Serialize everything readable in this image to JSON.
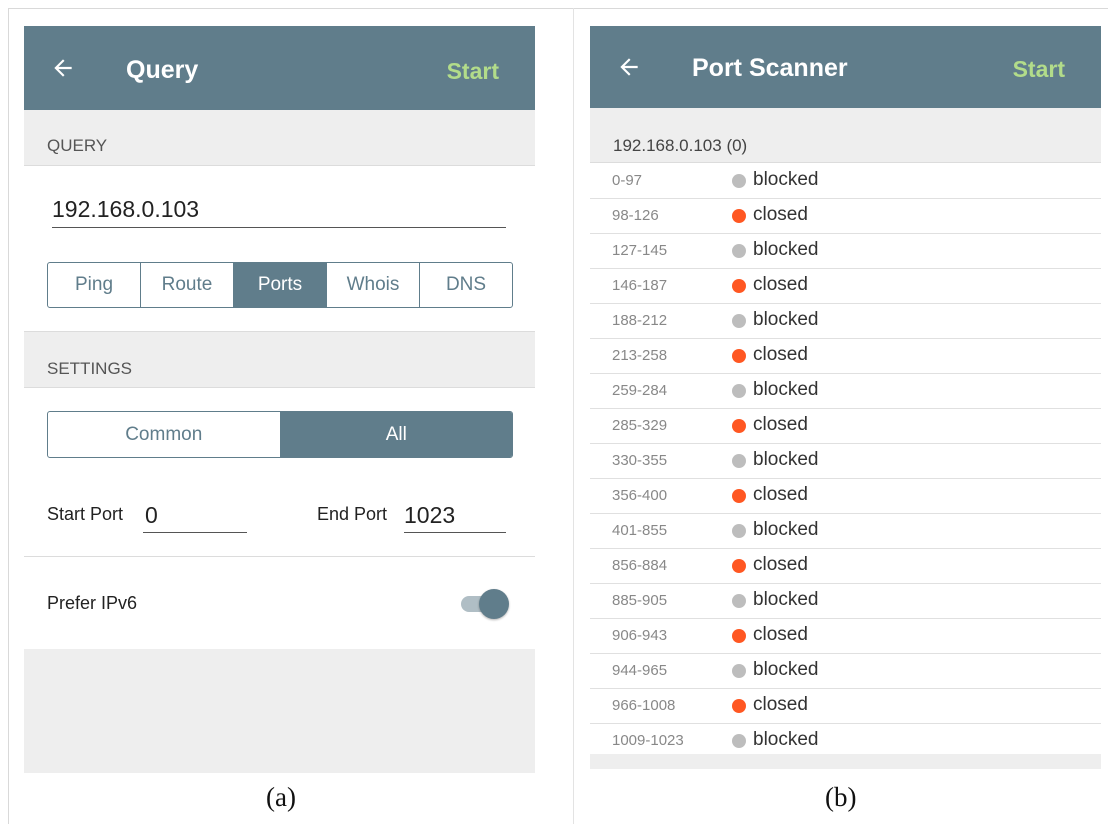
{
  "captions": {
    "a": "(a)",
    "b": "(b)"
  },
  "query_screen": {
    "appbar": {
      "back_icon": "arrow-left-icon",
      "title": "Query",
      "action": "Start"
    },
    "query_section": {
      "header": "QUERY",
      "ip_value": "192.168.0.103"
    },
    "tools": [
      {
        "label": "Ping",
        "active": false
      },
      {
        "label": "Route",
        "active": false
      },
      {
        "label": "Ports",
        "active": true
      },
      {
        "label": "Whois",
        "active": false
      },
      {
        "label": "DNS",
        "active": false
      }
    ],
    "settings": {
      "header": "SETTINGS",
      "scan_mode": [
        {
          "label": "Common",
          "active": false
        },
        {
          "label": "All",
          "active": true
        }
      ],
      "start_port_label": "Start Port",
      "start_port_value": "0",
      "end_port_label": "End Port",
      "end_port_value": "1023",
      "prefer_ipv6_label": "Prefer IPv6",
      "prefer_ipv6_on": true
    }
  },
  "port_scanner_screen": {
    "appbar": {
      "back_icon": "arrow-left-icon",
      "title": "Port Scanner",
      "action": "Start"
    },
    "host_header": "192.168.0.103 (0)",
    "status_colors": {
      "blocked": "#bdbdbd",
      "closed": "#ff5722"
    },
    "results": [
      {
        "range": "0-97",
        "status": "blocked"
      },
      {
        "range": "98-126",
        "status": "closed"
      },
      {
        "range": "127-145",
        "status": "blocked"
      },
      {
        "range": "146-187",
        "status": "closed"
      },
      {
        "range": "188-212",
        "status": "blocked"
      },
      {
        "range": "213-258",
        "status": "closed"
      },
      {
        "range": "259-284",
        "status": "blocked"
      },
      {
        "range": "285-329",
        "status": "closed"
      },
      {
        "range": "330-355",
        "status": "blocked"
      },
      {
        "range": "356-400",
        "status": "closed"
      },
      {
        "range": "401-855",
        "status": "blocked"
      },
      {
        "range": "856-884",
        "status": "closed"
      },
      {
        "range": "885-905",
        "status": "blocked"
      },
      {
        "range": "906-943",
        "status": "closed"
      },
      {
        "range": "944-965",
        "status": "blocked"
      },
      {
        "range": "966-1008",
        "status": "closed"
      },
      {
        "range": "1009-1023",
        "status": "blocked"
      }
    ]
  }
}
